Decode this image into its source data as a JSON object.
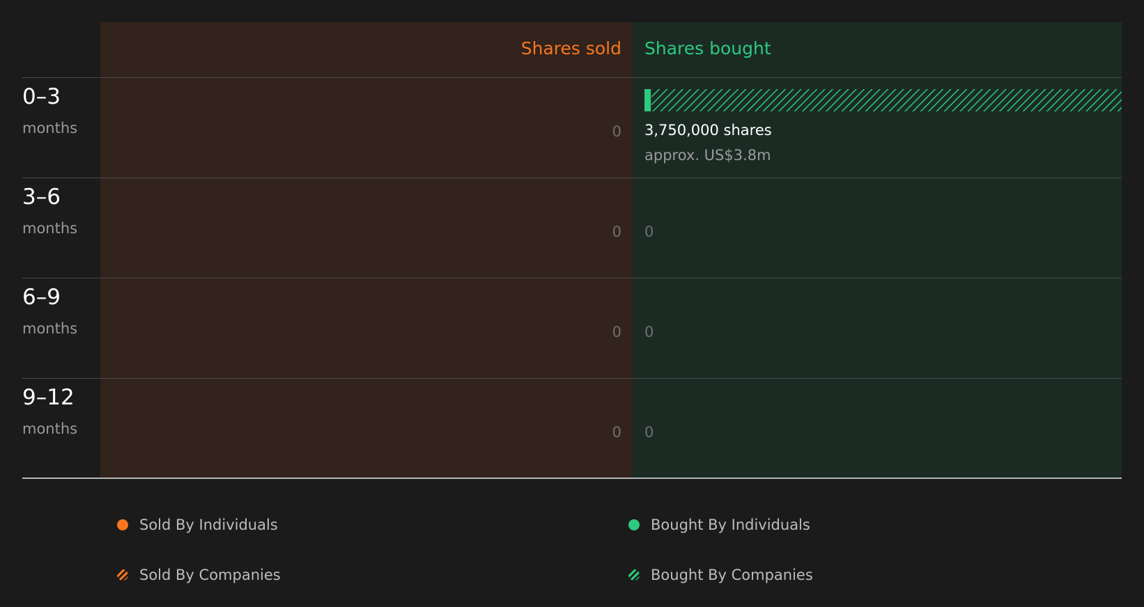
{
  "chart_data": {
    "type": "bar",
    "orientation": "horizontal-diverging",
    "categories": [
      {
        "range": "0–3",
        "unit": "months"
      },
      {
        "range": "3–6",
        "unit": "months"
      },
      {
        "range": "6–9",
        "unit": "months"
      },
      {
        "range": "9–12",
        "unit": "months"
      }
    ],
    "header_sold": "Shares sold",
    "header_bought": "Shares bought",
    "sold": {
      "labels": [
        "0",
        "0",
        "0",
        "0"
      ],
      "individuals": [
        0,
        0,
        0,
        0
      ],
      "companies": [
        0,
        0,
        0,
        0
      ]
    },
    "bought": {
      "labels": [
        "",
        "0",
        "0",
        "0"
      ],
      "individuals": [
        50000,
        0,
        0,
        0
      ],
      "companies": [
        3700000,
        0,
        0,
        0
      ]
    },
    "bar_annotation": {
      "shares": "3,750,000 shares",
      "value": "approx. US$3.8m"
    },
    "legend": {
      "sold_individuals": "Sold By Individuals",
      "sold_companies": "Sold By Companies",
      "bought_individuals": "Bought By Individuals",
      "bought_companies": "Bought By Companies"
    },
    "colors": {
      "sold": "#f8761f",
      "bought": "#2dc97e",
      "sold_panel": "#32231c",
      "bought_panel": "#1b2b24"
    }
  }
}
